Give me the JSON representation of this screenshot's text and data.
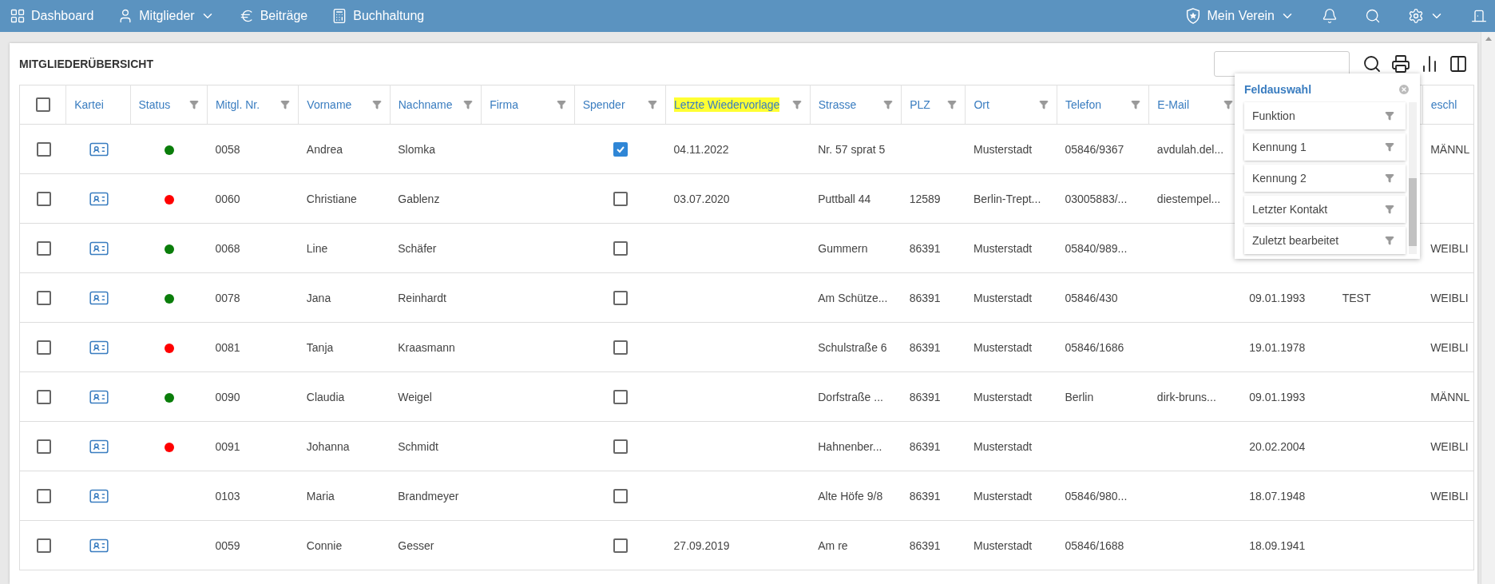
{
  "nav": {
    "left": [
      {
        "kind": "dashboard",
        "label": "Dashboard",
        "dropdown": false
      },
      {
        "kind": "members",
        "label": "Mitglieder",
        "dropdown": true
      },
      {
        "kind": "fees",
        "label": "Beiträge",
        "dropdown": false
      },
      {
        "kind": "accounting",
        "label": "Buchhaltung",
        "dropdown": false
      }
    ],
    "right": [
      {
        "kind": "club",
        "label": "Mein Verein",
        "dropdown": true
      },
      {
        "kind": "notifications",
        "dropdown": false
      },
      {
        "kind": "search",
        "dropdown": false
      },
      {
        "kind": "settings",
        "dropdown": true
      },
      {
        "kind": "exit",
        "dropdown": false
      }
    ]
  },
  "page": {
    "title": "MITGLIEDERÜBERSICHT"
  },
  "table": {
    "select_all": {
      "checked": false
    },
    "columns": [
      {
        "kind": "card",
        "label": "Kartei",
        "filter": false,
        "highlighted": false
      },
      {
        "kind": "status",
        "label": "Status",
        "filter": true,
        "highlighted": false
      },
      {
        "kind": "text",
        "label": "Mitgl. Nr.",
        "filter": true,
        "highlighted": false
      },
      {
        "kind": "text",
        "label": "Vorname",
        "filter": true,
        "highlighted": false
      },
      {
        "kind": "text",
        "label": "Nachname",
        "filter": true,
        "highlighted": false
      },
      {
        "kind": "text",
        "label": "Firma",
        "filter": true,
        "highlighted": false
      },
      {
        "kind": "check",
        "label": "Spender",
        "filter": true,
        "highlighted": false
      },
      {
        "kind": "text",
        "label": "Letzte Wiedervorlage",
        "filter": true,
        "highlighted": true
      },
      {
        "kind": "text",
        "label": "Strasse",
        "filter": true,
        "highlighted": false
      },
      {
        "kind": "text",
        "label": "PLZ",
        "filter": true,
        "highlighted": false
      },
      {
        "kind": "text",
        "label": "Ort",
        "filter": true,
        "highlighted": false
      },
      {
        "kind": "text",
        "label": "Telefon",
        "filter": true,
        "highlighted": false
      },
      {
        "kind": "text",
        "label": "E-Mail",
        "filter": true,
        "highlighted": false
      },
      {
        "kind": "text"
      },
      {
        "kind": "text"
      },
      {
        "kind": "text",
        "label": "eschl",
        "filter": false,
        "highlighted": false
      }
    ],
    "rows": [
      {
        "selected": false,
        "color": "#0a7d0a",
        "number": "0058",
        "first_name": "Andrea",
        "last_name": "Slomka",
        "donor": true,
        "follow_up": "04.11.2022",
        "street": "Nr. 57 sprat 5",
        "city": "Musterstadt",
        "phone": "05846/9367",
        "email": "avdulah.del...",
        "gender": "MÄNNL"
      },
      {
        "selected": false,
        "color": "#ff0000",
        "number": "0060",
        "first_name": "Christiane",
        "last_name": "Gablenz",
        "donor": false,
        "follow_up": "03.07.2020",
        "street": "Puttball 44",
        "zip": "12589",
        "city": "Berlin-Trept...",
        "phone": "03005883/...",
        "email": "diestempel..."
      },
      {
        "selected": false,
        "color": "#0a7d0a",
        "number": "0068",
        "first_name": "Line",
        "last_name": "Schäfer",
        "donor": false,
        "street": "Gummern",
        "zip": "86391",
        "city": "Musterstadt",
        "phone": "05840/989...",
        "gender": "WEIBLI"
      },
      {
        "selected": false,
        "color": "#0a7d0a",
        "number": "0078",
        "first_name": "Jana",
        "last_name": "Reinhardt",
        "donor": false,
        "street": "Am Schütze...",
        "zip": "86391",
        "city": "Musterstadt",
        "phone": "05846/430",
        "column_13": "09.01.1993",
        "column_14": "TEST",
        "gender": "WEIBLI"
      },
      {
        "selected": false,
        "color": "#ff0000",
        "number": "0081",
        "first_name": "Tanja",
        "last_name": "Kraasmann",
        "donor": false,
        "street": "Schulstraße 6",
        "zip": "86391",
        "city": "Musterstadt",
        "phone": "05846/1686",
        "column_13": "19.01.1978",
        "gender": "WEIBLI"
      },
      {
        "selected": false,
        "color": "#0a7d0a",
        "number": "0090",
        "first_name": "Claudia",
        "last_name": "Weigel",
        "donor": false,
        "street": "Dorfstraße ...",
        "zip": "86391",
        "city": "Musterstadt",
        "phone": "Berlin",
        "email": "dirk-bruns...",
        "column_13": "09.01.1993",
        "gender": "MÄNNL"
      },
      {
        "selected": false,
        "color": "#ff0000",
        "number": "0091",
        "first_name": "Johanna",
        "last_name": "Schmidt",
        "donor": false,
        "street": "Hahnenber...",
        "zip": "86391",
        "city": "Musterstadt",
        "column_13": "20.02.2004",
        "gender": "WEIBLI"
      },
      {
        "selected": false,
        "number": "0103",
        "first_name": "Maria",
        "last_name": "Brandmeyer",
        "donor": false,
        "street": "Alte Höfe 9/8",
        "zip": "86391",
        "city": "Musterstadt",
        "phone": "05846/980...",
        "column_13": "18.07.1948",
        "gender": "WEIBLI"
      },
      {
        "selected": false,
        "number": "0059",
        "first_name": "Connie",
        "last_name": "Gesser",
        "donor": false,
        "follow_up": "27.09.2019",
        "street": "Am re",
        "zip": "86391",
        "city": "Musterstadt",
        "phone": "05846/1688",
        "column_13": "18.09.1941"
      }
    ]
  },
  "field_picker": {
    "title": "Feldauswahl",
    "items": [
      {
        "label": "Funktion"
      },
      {
        "label": "Kennung 1"
      },
      {
        "label": "Kennung 2"
      },
      {
        "label": "Letzter Kontakt"
      },
      {
        "label": "Zuletzt bearbeitet"
      }
    ]
  }
}
